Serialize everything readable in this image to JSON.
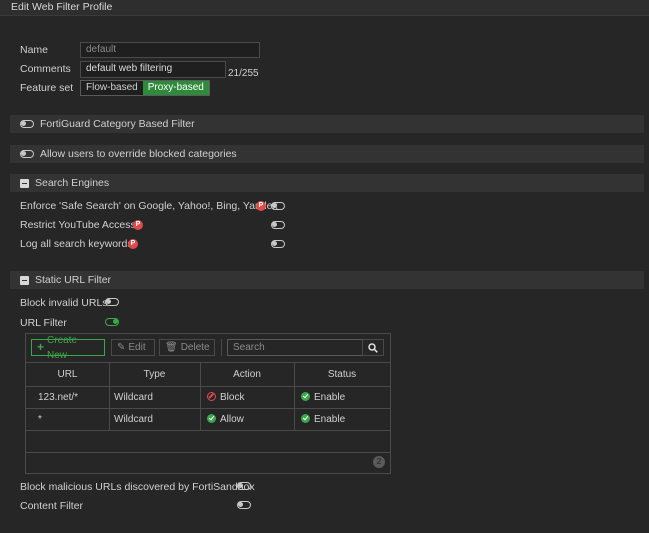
{
  "window": {
    "title": "Edit Web Filter Profile"
  },
  "form": {
    "name_label": "Name",
    "name_placeholder": "default",
    "comments_label": "Comments",
    "comments_value": "default web filtering",
    "comments_count": "21/255",
    "feature_set_label": "Feature set",
    "feature_options": [
      "Flow-based",
      "Proxy-based"
    ],
    "feature_selected": "Proxy-based"
  },
  "sections": {
    "fortiguard": "FortiGuard Category Based Filter",
    "override": "Allow users to override blocked categories",
    "search_engines": "Search Engines",
    "static_url": "Static URL Filter"
  },
  "search_engines": {
    "safe_search": "Enforce 'Safe Search' on Google, Yahoo!, Bing, Yandex",
    "youtube": "Restrict YouTube Access",
    "log_keywords": "Log all search keywords",
    "badge": "P"
  },
  "static_url": {
    "block_invalid": "Block invalid URLs",
    "url_filter": "URL Filter",
    "toolbar": {
      "create": "Create New",
      "edit": "Edit",
      "delete": "Delete",
      "search_placeholder": "Search"
    },
    "columns": [
      "URL",
      "Type",
      "Action",
      "Status"
    ],
    "rows": [
      {
        "url": "123.net/*",
        "type": "Wildcard",
        "action": "Block",
        "status": "Enable"
      },
      {
        "url": "*",
        "type": "Wildcard",
        "action": "Allow",
        "status": "Enable"
      }
    ],
    "count": "2"
  },
  "footer": {
    "block_malicious": "Block malicious URLs discovered by FortiSandbox",
    "content_filter": "Content Filter"
  },
  "colors": {
    "accent_green": "#3aa84a",
    "badge_red": "#e04a4a",
    "background": "#262626"
  }
}
